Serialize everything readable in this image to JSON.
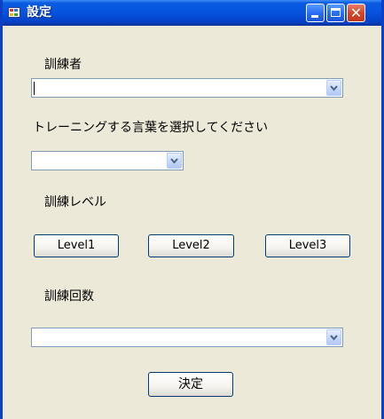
{
  "window": {
    "title": "設定",
    "controls": {
      "minimize_icon": "minimize-icon",
      "maximize_icon": "maximize-icon",
      "close_icon": "close-icon",
      "close_glyph": "✕"
    }
  },
  "trainee": {
    "label": "訓練者",
    "value": ""
  },
  "language": {
    "label": "トレーニングする言葉を選択してください",
    "value": ""
  },
  "level": {
    "label": "訓練レベル",
    "buttons": [
      "Level1",
      "Level2",
      "Level3"
    ]
  },
  "count": {
    "label": "訓練回数",
    "value": ""
  },
  "confirm": {
    "label": "決定"
  },
  "colors": {
    "titlebar": "#0655e0",
    "window_bg": "#ece9d8",
    "close_button": "#d8452a",
    "combo_border": "#7f9db9"
  }
}
